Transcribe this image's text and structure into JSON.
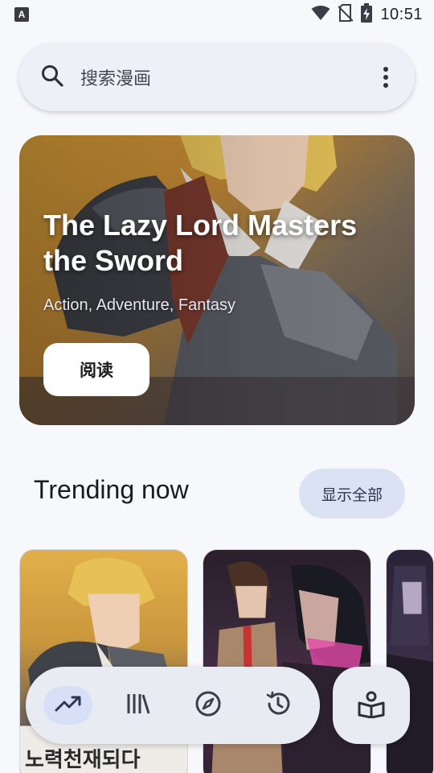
{
  "status_bar": {
    "app_badge": "A",
    "time": "10:51",
    "icons": [
      "wifi-icon",
      "no-sim-icon",
      "battery-charging-icon"
    ]
  },
  "search": {
    "placeholder": "搜索漫画",
    "icon": "search-icon",
    "menu_icon": "more-vert-icon"
  },
  "hero": {
    "title": "The Lazy Lord Masters the Sword",
    "genres": "Action, Adventure, Fantasy",
    "read_label": "阅读"
  },
  "trending": {
    "title": "Trending now",
    "show_all_label": "显示全部",
    "cards": [
      {
        "cover_text": "노력천재되다"
      },
      {
        "cover_text": ""
      },
      {
        "cover_text": ""
      }
    ]
  },
  "bottom_nav": {
    "items": [
      {
        "icon": "trending-icon",
        "active": true
      },
      {
        "icon": "library-icon",
        "active": false
      },
      {
        "icon": "explore-icon",
        "active": false
      },
      {
        "icon": "history-icon",
        "active": false
      }
    ],
    "fab_icon": "reader-icon"
  },
  "colors": {
    "background": "#f7f8fc",
    "surface": "#eef0f7",
    "accent_container": "#dbe2f4",
    "active_indicator": "#d7e0f6",
    "icon": "#3a3d46"
  }
}
